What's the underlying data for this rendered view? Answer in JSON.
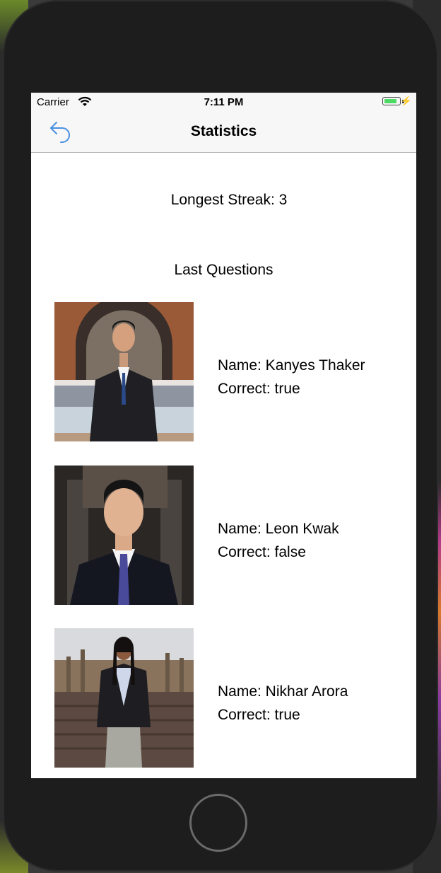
{
  "status_bar": {
    "carrier": "Carrier",
    "time": "7:11 PM"
  },
  "nav": {
    "title": "Statistics",
    "back_icon": "back-arrow-icon",
    "tint": "#4a90e2"
  },
  "streak": {
    "text": "Longest Streak: 3"
  },
  "last_questions": {
    "heading": "Last Questions",
    "entries": [
      {
        "name": "Name: Kanyes Thaker",
        "correct": "Correct: true"
      },
      {
        "name": "Name: Leon Kwak",
        "correct": "Correct: false"
      },
      {
        "name": "Name: Nikhar Arora",
        "correct": "Correct: true"
      }
    ]
  },
  "colors": {
    "battery": "#4cd964",
    "nav_background": "#f7f7f7",
    "phone_frame": "#1d1d1d"
  }
}
